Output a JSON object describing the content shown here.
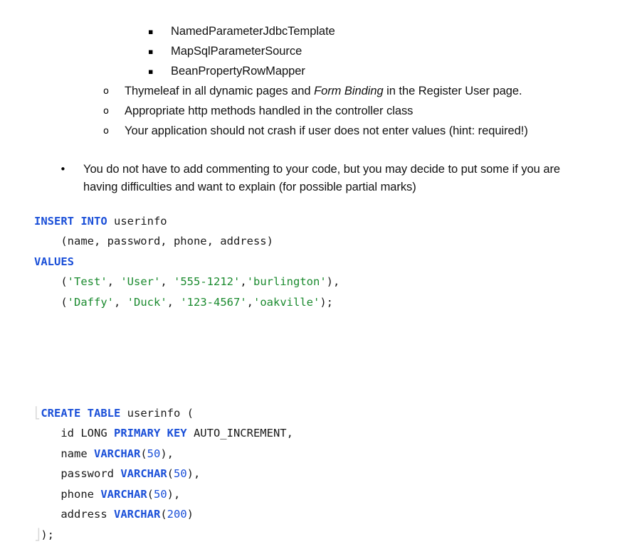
{
  "document": {
    "requirements_sublist": {
      "marker_glyph": "▪",
      "items": [
        {
          "text": "NamedParameterJdbcTemplate"
        },
        {
          "text": "MapSqlParameterSource"
        },
        {
          "text": "BeanPropertyRowMapper"
        }
      ]
    },
    "requirements_circle_list": {
      "marker_glyph": "o",
      "items": [
        {
          "segments": [
            {
              "text": "Thymeleaf in all dynamic pages and ",
              "style": "normal"
            },
            {
              "text": "Form Binding",
              "style": "italic"
            },
            {
              "text": " in the Register User page.",
              "style": "normal"
            }
          ]
        },
        {
          "segments": [
            {
              "text": "Appropriate http methods handled in the controller class",
              "style": "normal"
            }
          ]
        },
        {
          "segments": [
            {
              "text": "Your application should not crash if user does not enter values (hint: required!)",
              "style": "normal"
            }
          ]
        }
      ]
    },
    "commenting_note": {
      "marker_glyph": "•",
      "text": "You do not have to add commenting to your code, but you may decide to put some if you are having difficulties and want to explain (for possible partial marks)"
    }
  },
  "colors": {
    "background": "#ffffff",
    "text": "#111111",
    "keyword_blue": "#1a4fd8",
    "string_green": "#1a8a2e",
    "code_plain": "#1a1a1a",
    "ghost_clip": "#d7d7d7"
  },
  "code_blocks": [
    {
      "name": "insert-statement",
      "language": "sql",
      "plain_text": "INSERT INTO userinfo\n    (name, password, phone, address)\nVALUES\n    ('Test', 'User', '555-1212','burlington'),\n    ('Daffy', 'Duck', '123-4567','oakville');",
      "lines": [
        {
          "tokens": [
            {
              "t": "INSERT INTO",
              "k": "kw"
            },
            {
              "t": " userinfo",
              "k": "plain"
            }
          ]
        },
        {
          "tokens": [
            {
              "t": "    (name, password, phone, address)",
              "k": "plain"
            }
          ]
        },
        {
          "tokens": [
            {
              "t": "VALUES",
              "k": "kw"
            }
          ]
        },
        {
          "tokens": [
            {
              "t": "    (",
              "k": "plain"
            },
            {
              "t": "'Test'",
              "k": "str"
            },
            {
              "t": ", ",
              "k": "plain"
            },
            {
              "t": "'User'",
              "k": "str"
            },
            {
              "t": ", ",
              "k": "plain"
            },
            {
              "t": "'555-1212'",
              "k": "str"
            },
            {
              "t": ",",
              "k": "plain"
            },
            {
              "t": "'burlington'",
              "k": "str"
            },
            {
              "t": "),",
              "k": "plain"
            }
          ]
        },
        {
          "tokens": [
            {
              "t": "    (",
              "k": "plain"
            },
            {
              "t": "'Daffy'",
              "k": "str"
            },
            {
              "t": ", ",
              "k": "plain"
            },
            {
              "t": "'Duck'",
              "k": "str"
            },
            {
              "t": ", ",
              "k": "plain"
            },
            {
              "t": "'123-4567'",
              "k": "str"
            },
            {
              "t": ",",
              "k": "plain"
            },
            {
              "t": "'oakville'",
              "k": "str"
            },
            {
              "t": ");",
              "k": "plain"
            }
          ]
        }
      ]
    },
    {
      "name": "create-table-statement",
      "language": "sql",
      "plain_text": "CREATE TABLE userinfo (\n    id LONG PRIMARY KEY AUTO_INCREMENT,\n    name VARCHAR(50),\n    password VARCHAR(50),\n    phone VARCHAR(50),\n    address VARCHAR(200)\n);",
      "lines": [
        {
          "tokens": [
            {
              "t": "⎣",
              "k": "ghost"
            },
            {
              "t": "CREATE TABLE",
              "k": "kw"
            },
            {
              "t": " userinfo (",
              "k": "plain"
            }
          ]
        },
        {
          "tokens": [
            {
              "t": "    id LONG ",
              "k": "plain"
            },
            {
              "t": "PRIMARY KEY",
              "k": "kw"
            },
            {
              "t": " AUTO_INCREMENT,",
              "k": "plain"
            }
          ]
        },
        {
          "tokens": [
            {
              "t": "    name ",
              "k": "plain"
            },
            {
              "t": "VARCHAR",
              "k": "kw"
            },
            {
              "t": "(",
              "k": "plain"
            },
            {
              "t": "50",
              "k": "num"
            },
            {
              "t": "),",
              "k": "plain"
            }
          ]
        },
        {
          "tokens": [
            {
              "t": "    password ",
              "k": "plain"
            },
            {
              "t": "VARCHAR",
              "k": "kw"
            },
            {
              "t": "(",
              "k": "plain"
            },
            {
              "t": "50",
              "k": "num"
            },
            {
              "t": "),",
              "k": "plain"
            }
          ]
        },
        {
          "tokens": [
            {
              "t": "    phone ",
              "k": "plain"
            },
            {
              "t": "VARCHAR",
              "k": "kw"
            },
            {
              "t": "(",
              "k": "plain"
            },
            {
              "t": "50",
              "k": "num"
            },
            {
              "t": "),",
              "k": "plain"
            }
          ]
        },
        {
          "tokens": [
            {
              "t": "    address ",
              "k": "plain"
            },
            {
              "t": "VARCHAR",
              "k": "kw"
            },
            {
              "t": "(",
              "k": "plain"
            },
            {
              "t": "200",
              "k": "num"
            },
            {
              "t": ")",
              "k": "plain"
            }
          ]
        },
        {
          "tokens": [
            {
              "t": "⎦",
              "k": "ghost"
            },
            {
              "t": ");",
              "k": "plain"
            }
          ]
        }
      ]
    }
  ]
}
